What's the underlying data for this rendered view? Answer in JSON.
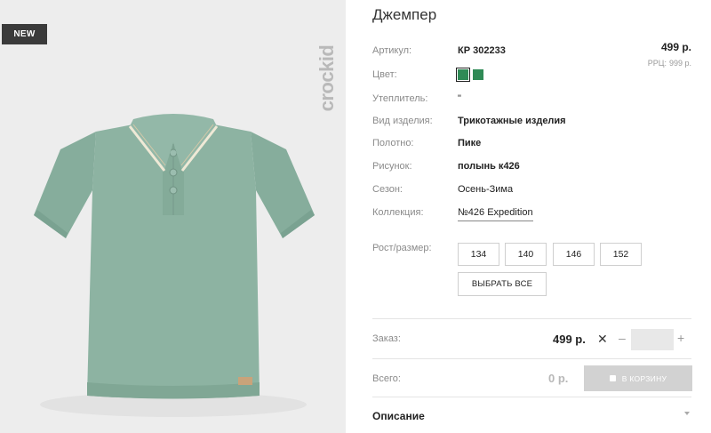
{
  "product": {
    "badge": "NEW",
    "brand": "crockid",
    "title": "Джемпер",
    "price": "499 р.",
    "rrp_label": "РРЦ:",
    "rrp_value": "999 р."
  },
  "attributes": {
    "article": {
      "label": "Артикул:",
      "value": "КР 302233"
    },
    "color": {
      "label": "Цвет:"
    },
    "insulation": {
      "label": "Утеплитель:",
      "value": "\""
    },
    "type": {
      "label": "Вид изделия:",
      "value": "Трикотажные изделия"
    },
    "fabric": {
      "label": "Полотно:",
      "value": "Пике"
    },
    "pattern": {
      "label": "Рисунок:",
      "value": "полынь к426"
    },
    "season": {
      "label": "Сезон:",
      "value": "Осень-Зима"
    },
    "collection": {
      "label": "Коллекция:",
      "value": "№426 Expedition"
    }
  },
  "colors": [
    "#2f8a56",
    "#2f8a56"
  ],
  "sizes": {
    "label": "Рост/размер:",
    "options": [
      "134",
      "140",
      "146",
      "152"
    ],
    "select_all": "ВЫБРАТЬ ВСЕ"
  },
  "order": {
    "label": "Заказ:",
    "price": "499 р.",
    "times": "✕",
    "minus": "–",
    "plus": "+",
    "quantity": ""
  },
  "total": {
    "label": "Всего:",
    "value": "0 р.",
    "cart_button": "В КОРЗИНУ"
  },
  "description": {
    "label": "Описание"
  }
}
